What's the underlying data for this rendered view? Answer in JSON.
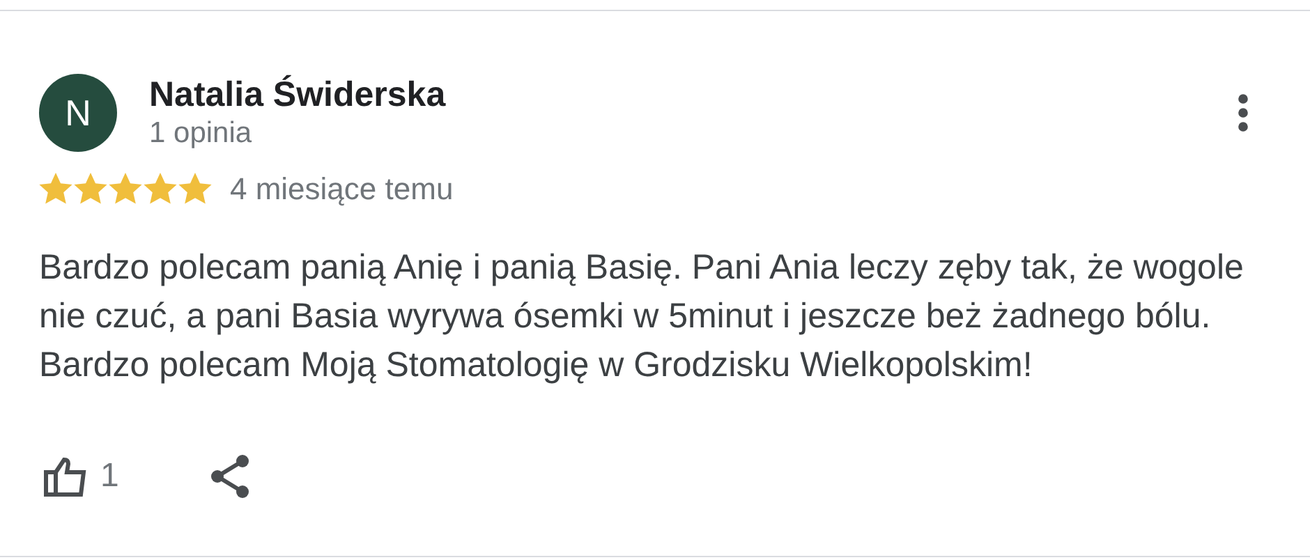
{
  "review": {
    "avatar_letter": "N",
    "author": "Natalia Świderska",
    "reviews_count": "1 opinia",
    "stars": 5,
    "date": "4 miesiące temu",
    "text": "Bardzo polecam panią Anię i panią Basię. Pani Ania leczy zęby tak, że wogole nie czuć, a pani Basia wyrywa ósemki w 5minut i jeszcze beż żadnego bólu. Bardzo polecam Moją Stomatologię w Grodzisku Wielkopolskim!",
    "likes": "1"
  }
}
